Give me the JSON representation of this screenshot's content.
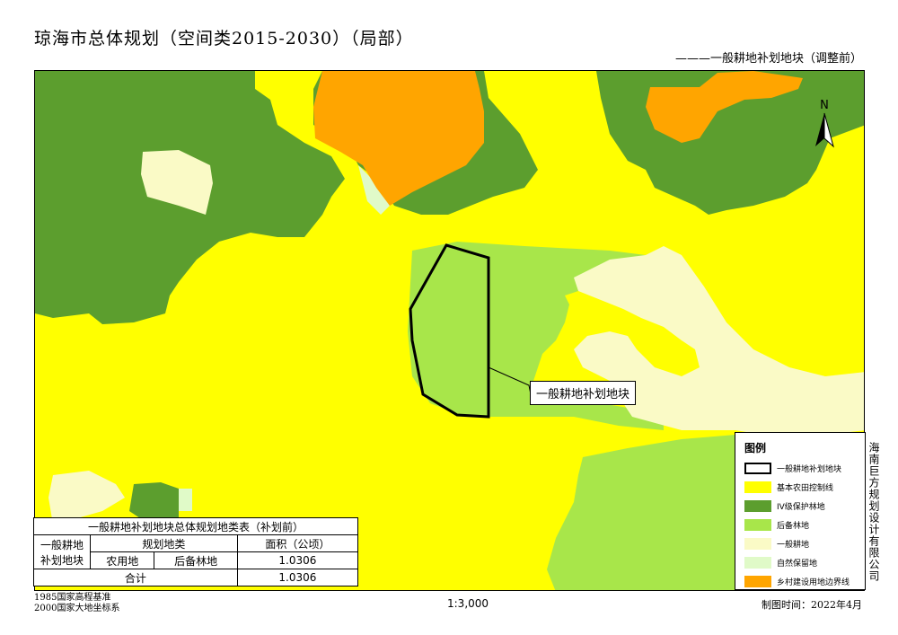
{
  "title": "琼海市总体规划（空间类2015-2030）（局部）",
  "subtitle": "———一般耕地补划地块（调整前）",
  "north_label": "N",
  "callout": "一般耕地补划地块",
  "table": {
    "caption": "一般耕地补划地块总体规划地类表（补划前）",
    "row_header": "一般耕地补划地块",
    "planning_class": "规划地类",
    "area_header": "面积（公顷）",
    "class_1": "农用地",
    "class_2": "后备林地",
    "area_value": "1.0306",
    "total_label": "合计",
    "total_value": "1.0306"
  },
  "legend": {
    "title": "图例",
    "items": [
      {
        "label": "一般耕地补划地块",
        "color": "#ffffff",
        "border": "#000000"
      },
      {
        "label": "基本农田控制线",
        "color": "#ffff00"
      },
      {
        "label": "IV级保护林地",
        "color": "#5c9e2e"
      },
      {
        "label": "后备林地",
        "color": "#a8e64a"
      },
      {
        "label": "一般耕地",
        "color": "#fafac6"
      },
      {
        "label": "自然保留地",
        "color": "#e0fac8"
      },
      {
        "label": "乡村建设用地边界线",
        "color": "#ffa500"
      }
    ]
  },
  "company": "海南巨方规划设计有限公司",
  "footer": {
    "line1": "1985国家高程基准",
    "line2": "2000国家大地坐标系",
    "scale": "1:3,000",
    "date": "制图时间：2022年4月"
  }
}
